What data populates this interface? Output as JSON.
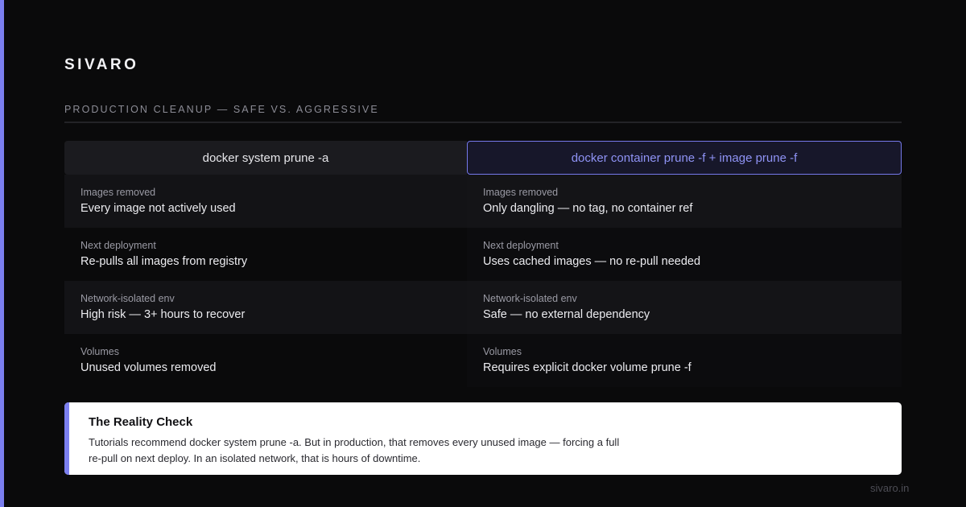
{
  "brand": "SIVARO",
  "subtitle": "PRODUCTION CLEANUP — SAFE VS. AGGRESSIVE",
  "columns": {
    "left": {
      "header": "docker system prune -a",
      "rows": [
        {
          "label": "Images removed",
          "value": "Every image not actively used"
        },
        {
          "label": "Next deployment",
          "value": "Re-pulls all images from registry"
        },
        {
          "label": "Network-isolated env",
          "value": "High risk — 3+ hours to recover"
        },
        {
          "label": "Volumes",
          "value": "Unused volumes removed"
        }
      ]
    },
    "right": {
      "header": "docker container prune -f + image prune -f",
      "rows": [
        {
          "label": "Images removed",
          "value": "Only dangling — no tag, no container ref"
        },
        {
          "label": "Next deployment",
          "value": "Uses cached images — no re-pull needed"
        },
        {
          "label": "Network-isolated env",
          "value": "Safe — no external dependency"
        },
        {
          "label": "Volumes",
          "value": "Requires explicit docker volume prune -f"
        }
      ]
    }
  },
  "callout": {
    "title": "The Reality Check",
    "body": "Tutorials recommend docker system prune -a. But in production, that removes every unused image — forcing a full re-pull on next deploy. In an isolated network, that is hours of downtime."
  },
  "footer": "sivaro.in",
  "colors": {
    "accent": "#7b7ff0",
    "background": "#0a0a0b",
    "callout_background": "#ffffff"
  }
}
